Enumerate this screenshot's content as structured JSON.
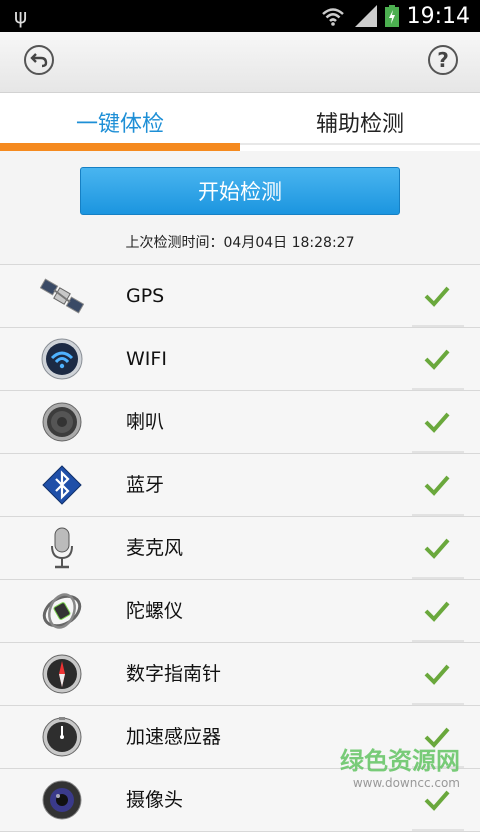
{
  "statusbar": {
    "time": "19:14",
    "battery_color": "#4caf50"
  },
  "header": {
    "back_icon": "back-arrow-icon",
    "help_label": "?"
  },
  "tabs": [
    {
      "label": "一键体检",
      "active": true
    },
    {
      "label": "辅助检测",
      "active": false
    }
  ],
  "main": {
    "start_button": "开始检测",
    "last_check": "上次检测时间：04月04日 18:28:27"
  },
  "items": [
    {
      "label": "GPS",
      "icon": "satellite-icon",
      "status": "ok"
    },
    {
      "label": "WIFI",
      "icon": "wifi-icon",
      "status": "ok"
    },
    {
      "label": "喇叭",
      "icon": "speaker-icon",
      "status": "ok"
    },
    {
      "label": "蓝牙",
      "icon": "bluetooth-icon",
      "status": "ok"
    },
    {
      "label": "麦克风",
      "icon": "microphone-icon",
      "status": "ok"
    },
    {
      "label": "陀螺仪",
      "icon": "gyroscope-icon",
      "status": "ok"
    },
    {
      "label": "数字指南针",
      "icon": "compass-icon",
      "status": "ok"
    },
    {
      "label": "加速感应器",
      "icon": "accelerometer-icon",
      "status": "ok"
    },
    {
      "label": "摄像头",
      "icon": "camera-icon",
      "status": "ok"
    }
  ],
  "watermark": {
    "name": "绿色资源网",
    "url": "www.downcc.com"
  },
  "colors": {
    "accent": "#1e8fd6",
    "tab_indicator": "#f58a1f",
    "check": "#6aa83c"
  }
}
